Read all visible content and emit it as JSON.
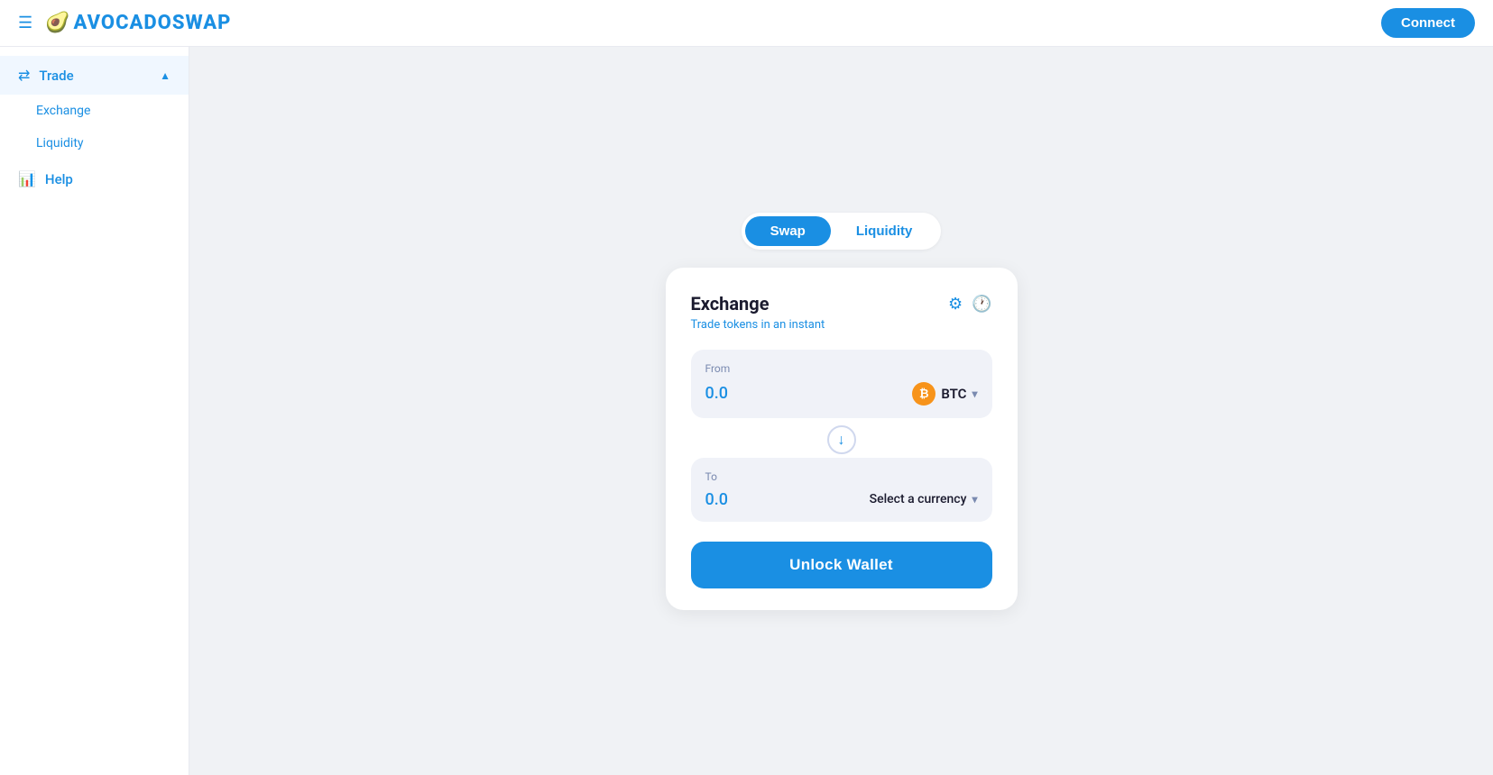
{
  "navbar": {
    "logo_text": "AVOCADOSWAP",
    "connect_label": "Connect"
  },
  "sidebar": {
    "trade_label": "Trade",
    "exchange_label": "Exchange",
    "liquidity_label": "Liquidity",
    "help_label": "Help"
  },
  "tabs": {
    "swap_label": "Swap",
    "liquidity_label": "Liquidity"
  },
  "exchange_card": {
    "title": "Exchange",
    "subtitle": "Trade tokens in an instant",
    "from_label": "From",
    "from_amount": "0.0",
    "from_token": "BTC",
    "to_label": "To",
    "to_amount": "0.0",
    "to_placeholder": "Select a currency",
    "unlock_label": "Unlock Wallet"
  }
}
